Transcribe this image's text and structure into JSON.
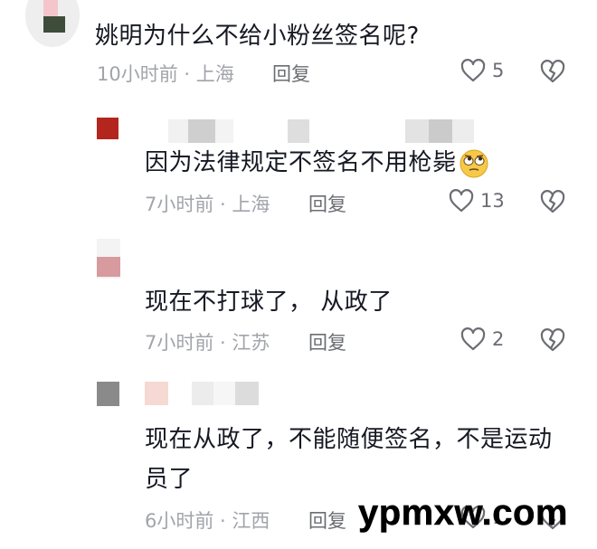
{
  "comments": [
    {
      "text": "姚明为什么不给小粉丝签名呢?",
      "time_location": "10小时前 · 上海",
      "reply_label": "回复",
      "like_count": "5"
    },
    {
      "text": "因为法律规定不签名不用枪毙",
      "emoji_icon": "face-with-rolling-eyes-icon",
      "time_location": "7小时前 · 上海",
      "reply_label": "回复",
      "like_count": "13"
    },
    {
      "text": "现在不打球了， 从政了",
      "time_location": "7小时前 · 江苏",
      "reply_label": "回复",
      "like_count": "2"
    },
    {
      "text_line1": "现在从政了，不能随便签名，不是运动",
      "text_line2": "员了",
      "time_location": "6小时前 · 江西",
      "reply_label": "回复",
      "like_count": "1"
    }
  ],
  "watermark": "ypmxw.com",
  "colors": {
    "primary_text": "#161823",
    "meta_text": "#a2a4ab",
    "icon": "#6b6d73"
  }
}
